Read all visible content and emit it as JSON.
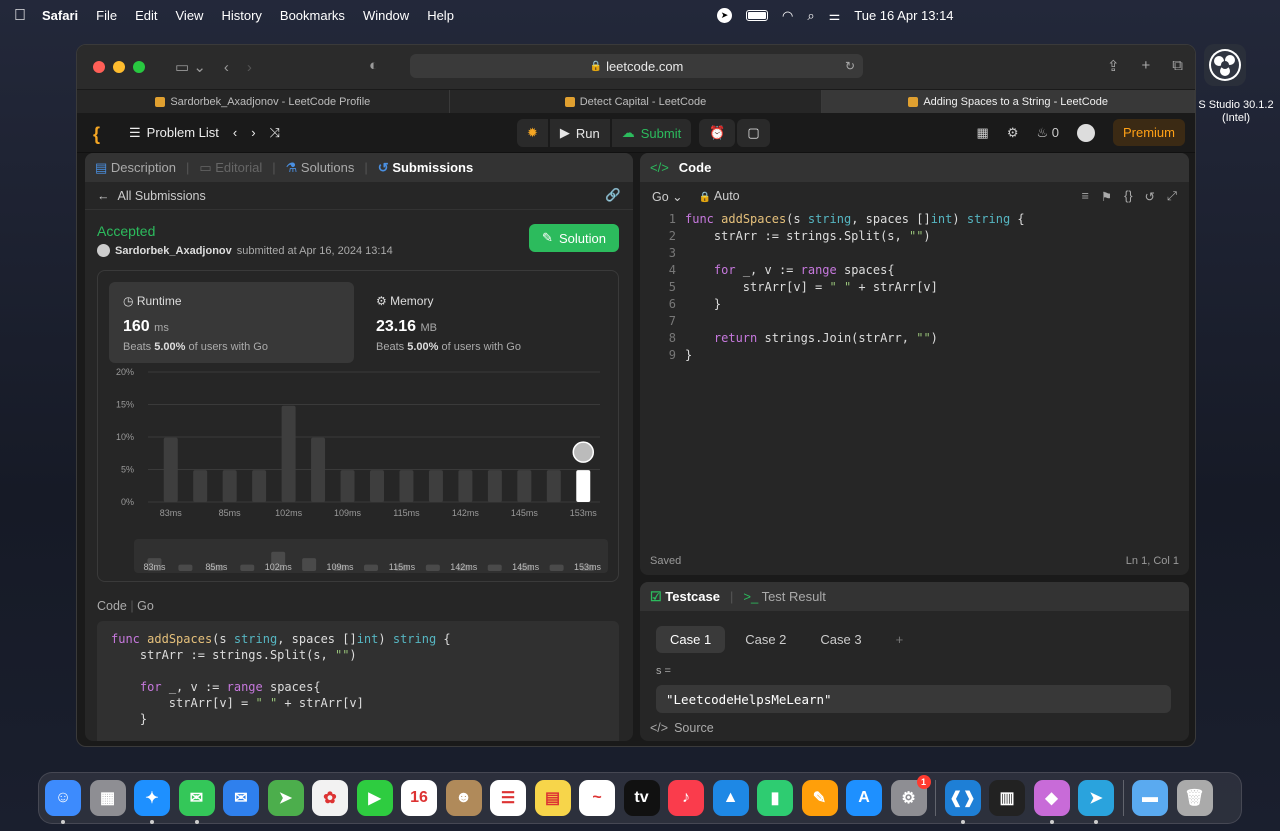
{
  "menubar": {
    "app": "Safari",
    "items": [
      "File",
      "Edit",
      "View",
      "History",
      "Bookmarks",
      "Window",
      "Help"
    ],
    "datetime": "Tue 16 Apr  13:14"
  },
  "browser": {
    "url": "leetcode.com",
    "tabs": [
      {
        "label": "Sardorbek_Axadjonov - LeetCode Profile",
        "active": false
      },
      {
        "label": "Detect Capital - LeetCode",
        "active": false
      },
      {
        "label": "Adding Spaces to a String - LeetCode",
        "active": true
      }
    ]
  },
  "lcnav": {
    "problem_list": "Problem List",
    "run": "Run",
    "submit": "Submit",
    "streak": "0",
    "premium": "Premium"
  },
  "left_tabs": {
    "description": "Description",
    "editorial": "Editorial",
    "solutions": "Solutions",
    "submissions": "Submissions"
  },
  "submission": {
    "back": "All Submissions",
    "status": "Accepted",
    "user": "Sardorbek_Axadjonov",
    "submitted": "submitted at Apr 16, 2024 13:14",
    "solution_btn": "Solution",
    "runtime": {
      "title": "Runtime",
      "value": "160",
      "unit": "ms",
      "beats_prefix": "Beats",
      "pct": "5.00%",
      "suffix": "of users with Go"
    },
    "memory": {
      "title": "Memory",
      "value": "23.16",
      "unit": "MB",
      "beats_prefix": "Beats",
      "pct": "5.00%",
      "suffix": "of users with Go"
    }
  },
  "chart_data": {
    "type": "bar",
    "title": "",
    "xlabel": "",
    "ylabel": "",
    "ylim": [
      0,
      20
    ],
    "yticks": [
      "0%",
      "5%",
      "10%",
      "15%",
      "20%"
    ],
    "xticklabels": [
      "83ms",
      "85ms",
      "102ms",
      "109ms",
      "115ms",
      "142ms",
      "145ms",
      "153ms"
    ],
    "values": [
      9.9,
      4.9,
      4.9,
      4.9,
      14.8,
      9.9,
      4.9,
      4.9,
      4.9,
      4.9,
      4.9,
      4.9,
      4.9,
      4.9,
      4.9
    ],
    "highlight_index": 14,
    "mini_values": [
      9.9,
      4.9,
      4.9,
      4.9,
      14.8,
      9.9,
      4.9,
      4.9,
      4.9,
      4.9,
      4.9,
      4.9,
      4.9,
      4.9,
      4.9
    ]
  },
  "code_section": {
    "label": "Code",
    "lang": "Go"
  },
  "submitted_code": [
    "func addSpaces(s string, spaces []int) string {",
    "    strArr := strings.Split(s, \"\")",
    "",
    "    for _, v := range spaces{",
    "        strArr[v] = \" \" + strArr[v]",
    "    }"
  ],
  "editor": {
    "title": "Code",
    "lang": "Go",
    "mode": "Auto",
    "lines": [
      "func addSpaces(s string, spaces []int) string {",
      "    strArr := strings.Split(s, \"\")",
      "",
      "    for _, v := range spaces{",
      "        strArr[v] = \" \" + strArr[v]",
      "    }",
      "",
      "    return strings.Join(strArr, \"\")",
      "}"
    ],
    "line_numbers": [
      "1",
      "2",
      "3",
      "4",
      "5",
      "6",
      "7",
      "8",
      "9"
    ],
    "saved": "Saved",
    "cursor": "Ln 1, Col 1"
  },
  "testpanel": {
    "testcase": "Testcase",
    "result": "Test Result",
    "cases": [
      "Case 1",
      "Case 2",
      "Case 3"
    ],
    "add": "+",
    "var": "s =",
    "value": "\"LeetcodeHelpsMeLearn\"",
    "source": "Source"
  },
  "obs": {
    "label": "S Studio 30.1.2 (Intel)"
  },
  "dock": {
    "apps": [
      {
        "name": "Finder",
        "color": "#3d8bfd",
        "glyph": "☺",
        "running": true
      },
      {
        "name": "Launchpad",
        "color": "#8e8e93",
        "glyph": "▦",
        "running": false
      },
      {
        "name": "Safari",
        "color": "#1e90ff",
        "glyph": "✦",
        "running": true
      },
      {
        "name": "Messages",
        "color": "#34c759",
        "glyph": "✉",
        "running": true
      },
      {
        "name": "Mail",
        "color": "#2f80ed",
        "glyph": "✉",
        "running": false
      },
      {
        "name": "Maps",
        "color": "#4cae4c",
        "glyph": "➤",
        "running": false
      },
      {
        "name": "Photos",
        "color": "#f2f2f2",
        "glyph": "✿",
        "running": false
      },
      {
        "name": "FaceTime",
        "color": "#2ecc40",
        "glyph": "▶",
        "running": false
      },
      {
        "name": "Calendar",
        "color": "#ffffff",
        "glyph": "16",
        "running": false
      },
      {
        "name": "Contacts",
        "color": "#b08a5a",
        "glyph": "☻",
        "running": false
      },
      {
        "name": "Reminders",
        "color": "#ffffff",
        "glyph": "☰",
        "running": false
      },
      {
        "name": "Notes",
        "color": "#f7d54a",
        "glyph": "▤",
        "running": false
      },
      {
        "name": "Freeform",
        "color": "#ffffff",
        "glyph": "~",
        "running": false
      },
      {
        "name": "TV",
        "color": "#111111",
        "glyph": "tv",
        "running": false
      },
      {
        "name": "Music",
        "color": "#fa3c4c",
        "glyph": "♪",
        "running": false
      },
      {
        "name": "Keynote",
        "color": "#1e88e5",
        "glyph": "▲",
        "running": false
      },
      {
        "name": "Numbers",
        "color": "#2ecc71",
        "glyph": "▮",
        "running": false
      },
      {
        "name": "Pages",
        "color": "#ff9f0a",
        "glyph": "✎",
        "running": false
      },
      {
        "name": "App Store",
        "color": "#1e90ff",
        "glyph": "A",
        "running": false
      },
      {
        "name": "System Settings",
        "color": "#8e8e93",
        "glyph": "⚙",
        "running": false,
        "badge": "1"
      },
      {
        "name": "VS Code",
        "color": "#1e7fd6",
        "glyph": "❰❱",
        "running": true
      },
      {
        "name": "Piano",
        "color": "#222222",
        "glyph": "▥",
        "running": false
      },
      {
        "name": "Gem",
        "color": "#c86bd8",
        "glyph": "◆",
        "running": true
      },
      {
        "name": "Telegram",
        "color": "#2aa3dd",
        "glyph": "➤",
        "running": true
      },
      {
        "name": "Folder",
        "color": "#5aaaf0",
        "glyph": "▬",
        "running": false
      },
      {
        "name": "Trash",
        "color": "#aaaaaa",
        "glyph": "🗑",
        "running": false
      }
    ]
  }
}
